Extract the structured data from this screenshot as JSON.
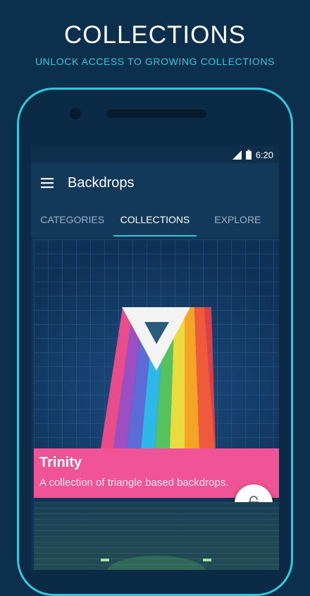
{
  "promo": {
    "title": "COLLECTIONS",
    "subtitle": "UNLOCK ACCESS TO GROWING COLLECTIONS"
  },
  "status_bar": {
    "time": "6:20"
  },
  "app": {
    "title": "Backdrops"
  },
  "tabs": [
    {
      "label": "CATEGORIES",
      "active": false
    },
    {
      "label": "COLLECTIONS",
      "active": true
    },
    {
      "label": "EXPLORE",
      "active": false
    }
  ],
  "card": {
    "title": "Trinity",
    "description": "A collection of triangle based backdrops."
  },
  "fab_icon": "lock-icon",
  "colors": {
    "accent": "#2fc9dc",
    "background": "#0d2f4e",
    "card_info": "#f15397"
  }
}
